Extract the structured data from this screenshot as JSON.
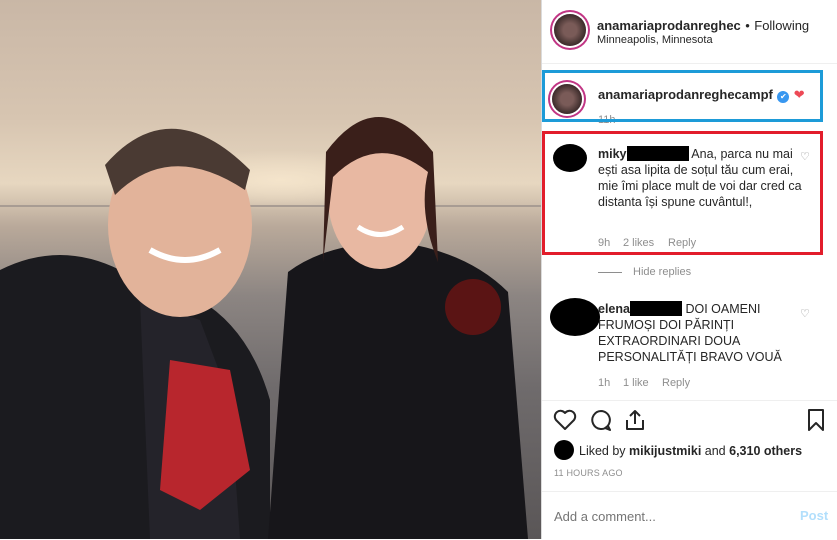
{
  "header": {
    "username": "anamariaprodanreghec",
    "separator": "•",
    "follow_status": "Following",
    "location": "Minneapolis, Minnesota"
  },
  "caption": {
    "username": "anamariaprodanreghecampf",
    "verified_glyph": "✔",
    "heart_glyph": "❤",
    "time": "11h"
  },
  "comments": [
    {
      "username_prefix": "miky",
      "text": "Ana, parca nu mai ești asa lipita de soțul tău cum erai, mie îmi place mult de voi dar cred ca distanta își spune cuvântul!,",
      "time": "9h",
      "likes": "2 likes",
      "reply": "Reply"
    },
    {
      "username_prefix": "elena",
      "text": "DOI OAMENI FRUMOȘI DOI PĂRINȚI EXTRAORDINARI DOUA PERSONALITĂȚI BRAVO VOUĂ",
      "time": "1h",
      "likes": "1 like",
      "reply": "Reply"
    }
  ],
  "hide_replies": "Hide replies",
  "actions": {
    "like_icon": "heart-outline-icon",
    "comment_icon": "comment-bubble-icon",
    "share_icon": "share-arrow-icon",
    "save_icon": "bookmark-icon"
  },
  "liked_by": {
    "prefix": "Liked by",
    "user": "mikijustmiki",
    "and": "and",
    "others": "6,310 others"
  },
  "timestamp": "11 HOURS AGO",
  "add_comment": {
    "placeholder": "Add a comment...",
    "post_label": "Post"
  },
  "colors": {
    "blue_highlight": "#1d9bd8",
    "red_highlight": "#e21d2b",
    "verified": "#3897f0",
    "heart": "#ed4956",
    "post_disabled": "#b2dffc"
  }
}
